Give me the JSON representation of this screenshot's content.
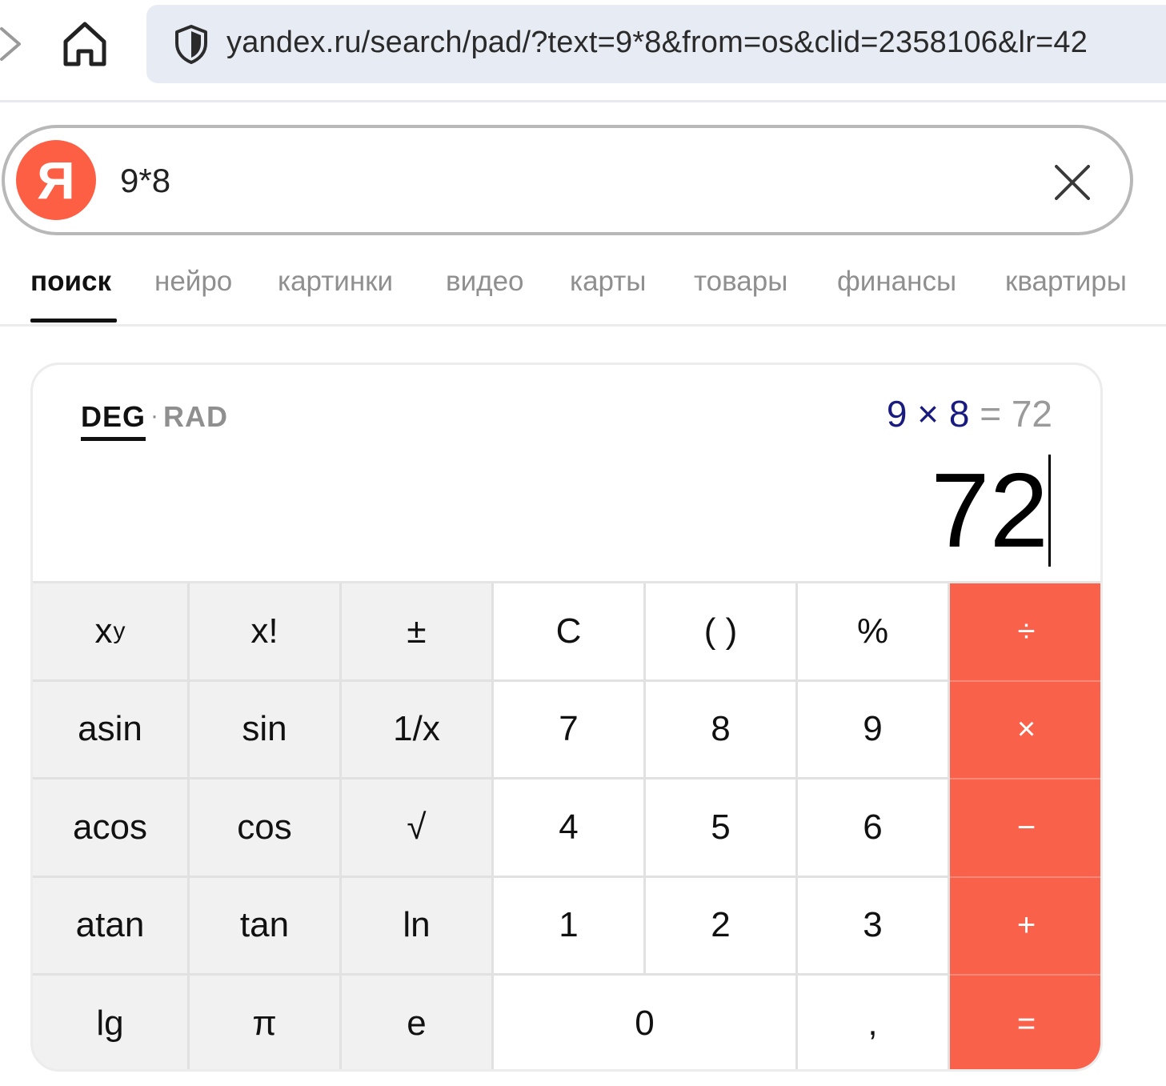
{
  "browser": {
    "url": "yandex.ru/search/pad/?text=9*8&from=os&clid=2358106&lr=42",
    "icons": [
      "forward-icon",
      "home-icon",
      "shield-icon"
    ]
  },
  "search": {
    "logo_letter": "Я",
    "query": "9*8",
    "logo_color": "#fc5f44"
  },
  "tabs": [
    {
      "label": "поиск",
      "active": true
    },
    {
      "label": "нейро"
    },
    {
      "label": "картинки"
    },
    {
      "label": "видео"
    },
    {
      "label": "карты"
    },
    {
      "label": "товары"
    },
    {
      "label": "финансы"
    },
    {
      "label": "квартиры"
    }
  ],
  "calculator": {
    "mode": {
      "deg": "DEG",
      "separator": "·",
      "rad": "RAD",
      "selected": "DEG"
    },
    "expression": "9 × 8",
    "equals_result": "= 72",
    "display": "72",
    "accent_color": "#f9614b",
    "keys": [
      [
        "xʸ",
        "x!",
        "±",
        "C",
        "( )",
        "%",
        "÷"
      ],
      [
        "asin",
        "sin",
        "1/x",
        "7",
        "8",
        "9",
        "×"
      ],
      [
        "acos",
        "cos",
        "√",
        "4",
        "5",
        "6",
        "−"
      ],
      [
        "atan",
        "tan",
        "ln",
        "1",
        "2",
        "3",
        "+"
      ],
      [
        "lg",
        "π",
        "e",
        "0",
        ",",
        "="
      ]
    ],
    "key_power_base": "x",
    "key_power_exp": "y"
  }
}
